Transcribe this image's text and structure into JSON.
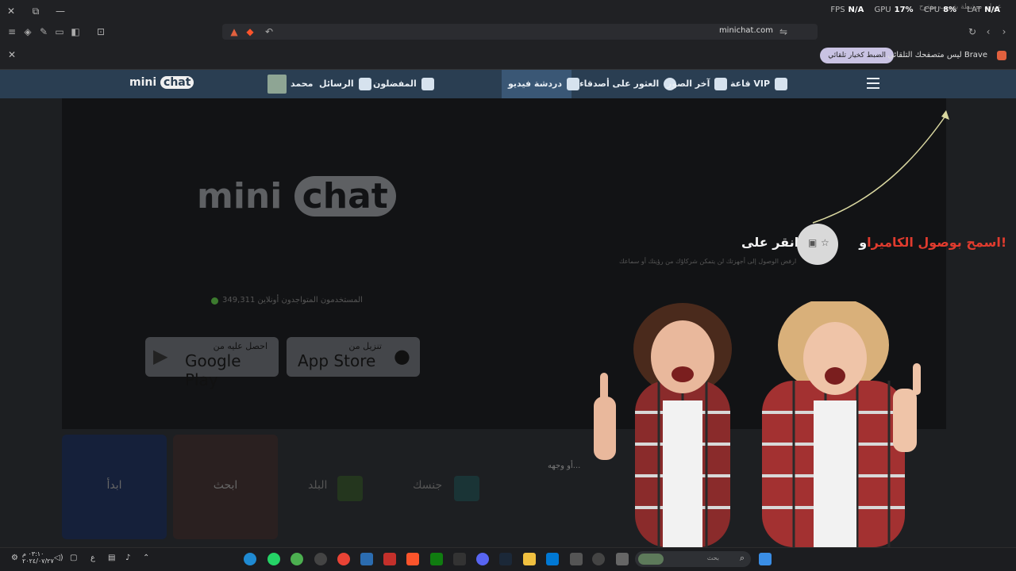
{
  "window": {
    "close_glyph": "✕",
    "restore_glyph": "⧉",
    "minimize_glyph": "—",
    "tab_ghost": "عنوان مرتبطة بتبويب مفتوح"
  },
  "perf": {
    "fps_label": "FPS",
    "fps_value": "N/A",
    "gpu_label": "GPU",
    "gpu_value": "17%",
    "cpu_label": "CPU",
    "cpu_value": "8%",
    "lat_label": "LAT",
    "lat_value": "N/A"
  },
  "toolbar": {
    "address": "minichat.com"
  },
  "notification": {
    "text": "Brave ليس متصفحك التلقائي.",
    "button": "الضبط كخيار تلقائي",
    "close_glyph": "✕"
  },
  "nav": {
    "logo_mini": "mini",
    "logo_chat": "chat",
    "profile": "محمد",
    "messages": "الرسائل",
    "favorites": "المفضلون",
    "video_chat": "دردشة فيديو",
    "find_friends": "العثور على أصدقاء",
    "latest_photos": "آخر الصور",
    "vip": "VIP قاعة"
  },
  "hero": {
    "logo_mini": "mini",
    "logo_chat": "chat",
    "online_text": "المستخدمون المتواجدون أونلاين 349,311",
    "google_small": "احصل عليه من",
    "google_big": "Google Play",
    "apple_small": "تنزيل من",
    "apple_big": "App Store"
  },
  "prompt": {
    "part1": "!اسمح بوصول الكاميرا",
    "part2": "و",
    "part3": "انقر على",
    "subtitle": "ارفض الوصول إلى أجهزتك لن يتمكن شركاؤك من رؤيتك أو سماعك"
  },
  "cards": {
    "start": "ابدأ",
    "card2": "ابحث",
    "city": "البلد",
    "gender": "جنسك",
    "hint": "...أو وجهه"
  },
  "taskbar": {
    "search": "بحث",
    "clock_time": "٠٣:١٠ م",
    "clock_date": "٢٠٢٤/٠٧/٢٧"
  },
  "colors": {
    "nav_bg": "#2a3e52",
    "prompt_red": "#e03b2e",
    "notif_button": "#c9c3e3"
  }
}
